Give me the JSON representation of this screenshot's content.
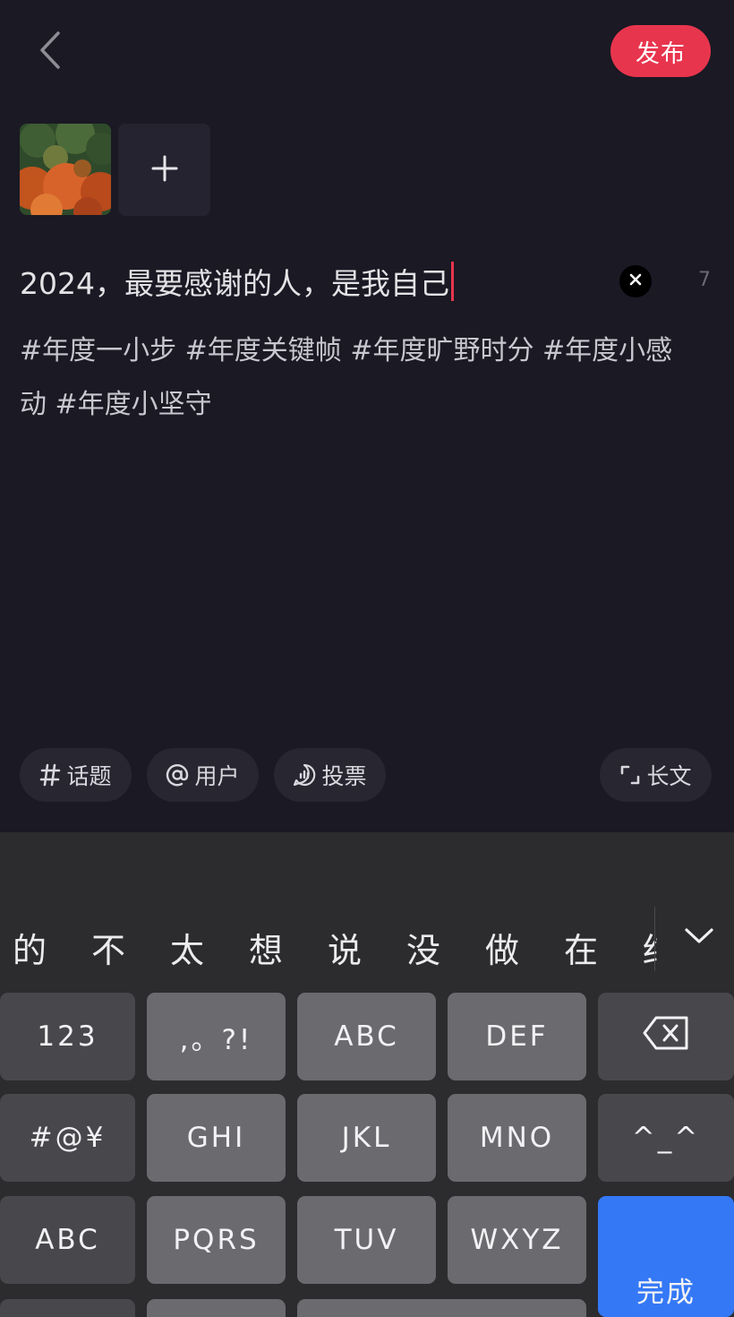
{
  "header": {
    "back_icon": "chevron-left-icon",
    "publish_label": "发布"
  },
  "media": {
    "add_icon": "plus-icon"
  },
  "editor": {
    "title": "2024，最要感谢的人，是我自己",
    "clear_icon": "close-icon",
    "char_count": "7",
    "body_line1": "#年度一小步 #年度关键帧 #年度旷野时分 #年度小感",
    "body_line2": "动 #年度小坚守"
  },
  "toolbar": {
    "topic_label": "话题",
    "user_label": "用户",
    "vote_label": "投票",
    "longtext_label": "长文"
  },
  "keyboard": {
    "candidates": [
      "的",
      "不",
      "太",
      "想",
      "说",
      "没",
      "做",
      "在",
      "结"
    ],
    "rows": [
      [
        "123",
        ",。?!",
        "ABC",
        "DEF",
        "⌫"
      ],
      [
        "#@¥",
        "GHI",
        "JKL",
        "MNO",
        "^_^"
      ],
      [
        "ABC",
        "PQRS",
        "TUV",
        "WXYZ",
        "完成"
      ]
    ],
    "done_color": "#3478f6"
  },
  "colors": {
    "accent": "#e8354e",
    "background": "#1a1924"
  }
}
